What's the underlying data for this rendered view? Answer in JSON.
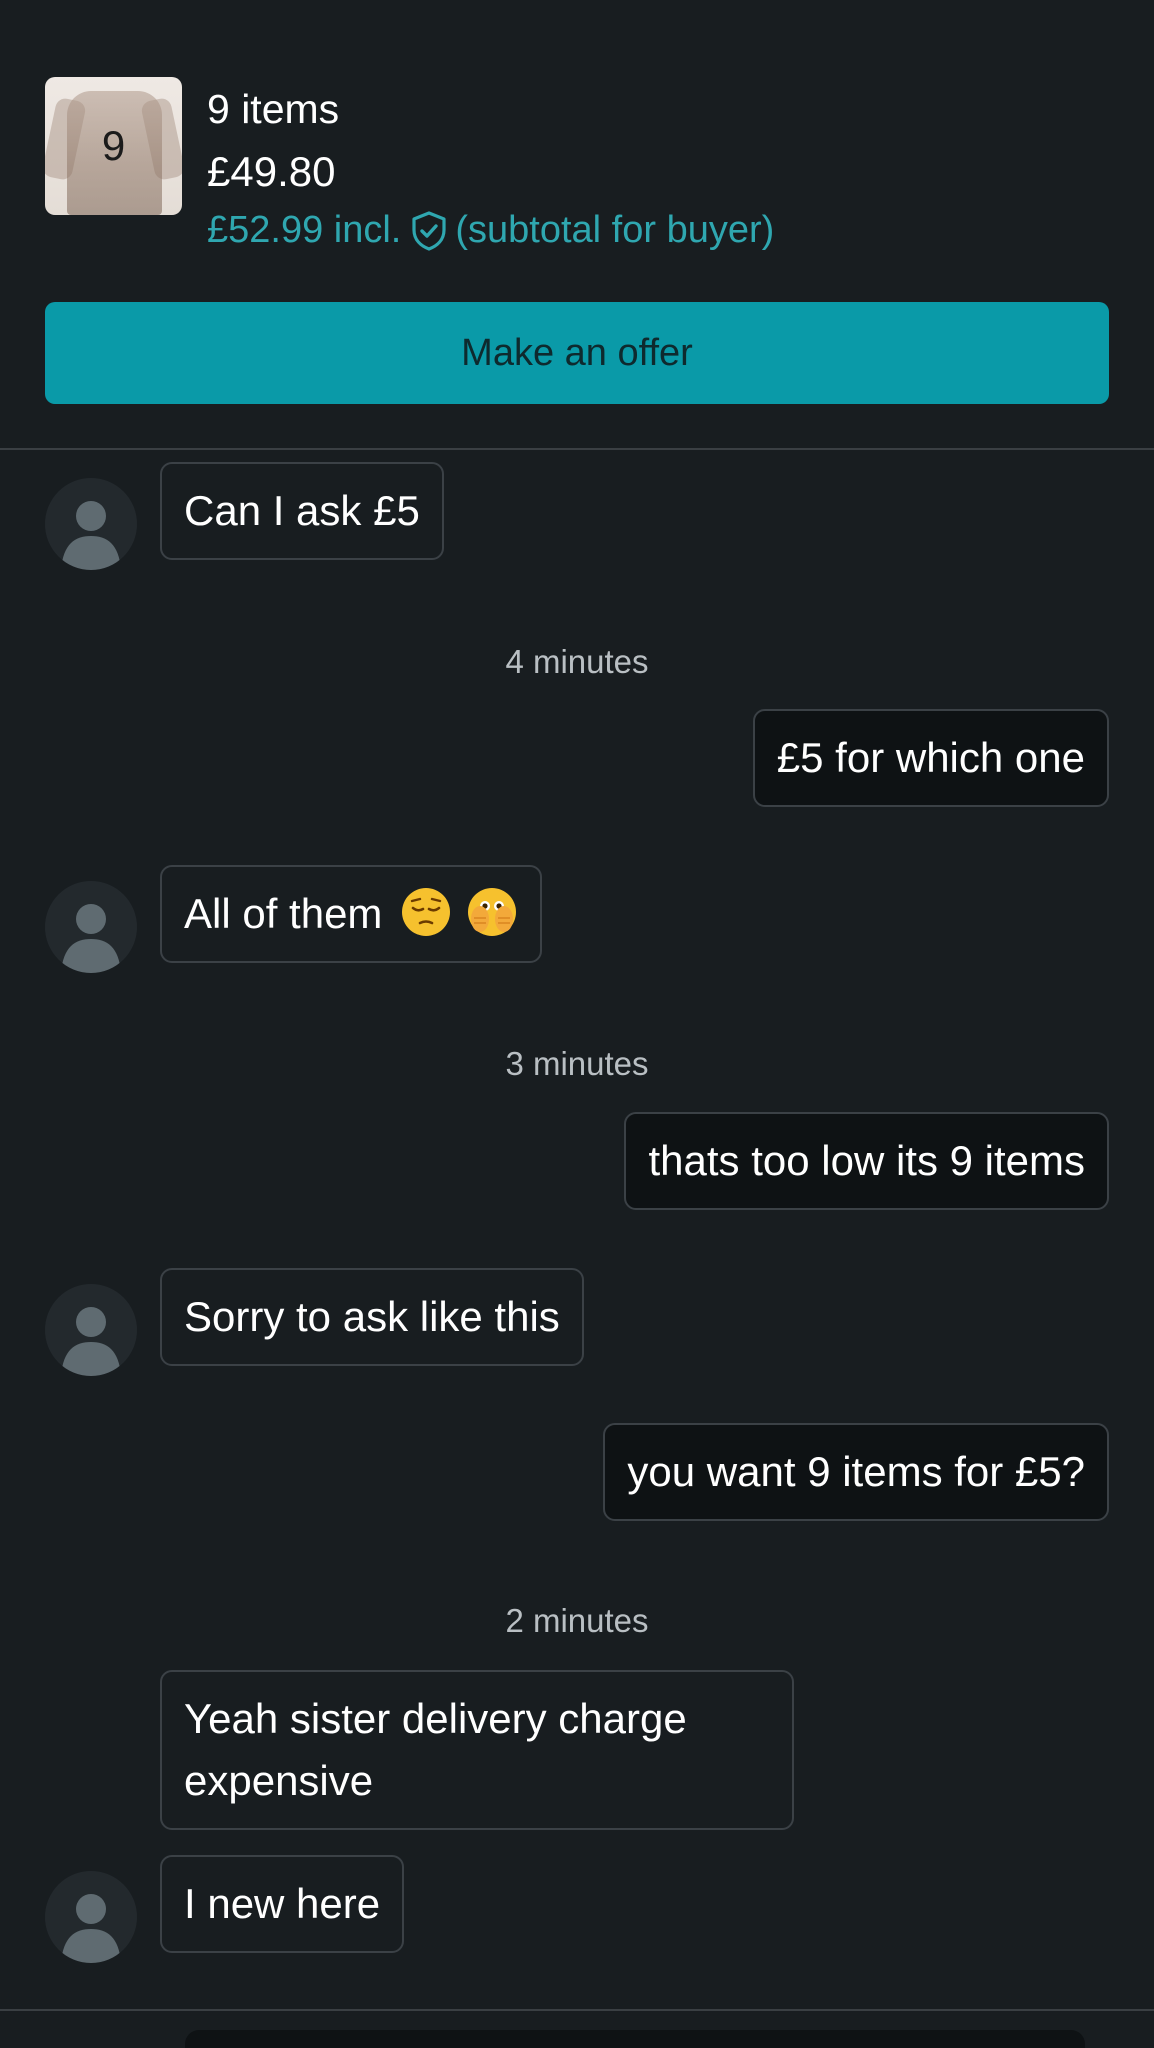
{
  "header": {
    "thumb_count": "9",
    "items_title": "9 items",
    "price": "£49.80",
    "buyer_price": "£52.99 incl.",
    "buyer_note": "(subtotal for buyer)",
    "offer_button": "Make an offer"
  },
  "messages": [
    {
      "text": "Can I ask £5"
    },
    {
      "text": "£5 for which one"
    },
    {
      "text": "All of them",
      "emojis": [
        "pensive-face-emoji",
        "face-with-open-eyes-and-hand-over-mouth-emoji"
      ]
    },
    {
      "text": "thats too low its 9 items"
    },
    {
      "text": "Sorry to ask like this"
    },
    {
      "text": "you want 9 items for £5?"
    },
    {
      "text": "Yeah sister delivery charge expensive"
    },
    {
      "text": "I new here"
    }
  ],
  "timestamps": [
    "4 minutes",
    "3 minutes",
    "2 minutes"
  ],
  "colors": {
    "background": "#181d20",
    "accent": "#0a9aa8",
    "buyer_price": "#2fa7b0",
    "bubble_border": "#3b4146"
  }
}
